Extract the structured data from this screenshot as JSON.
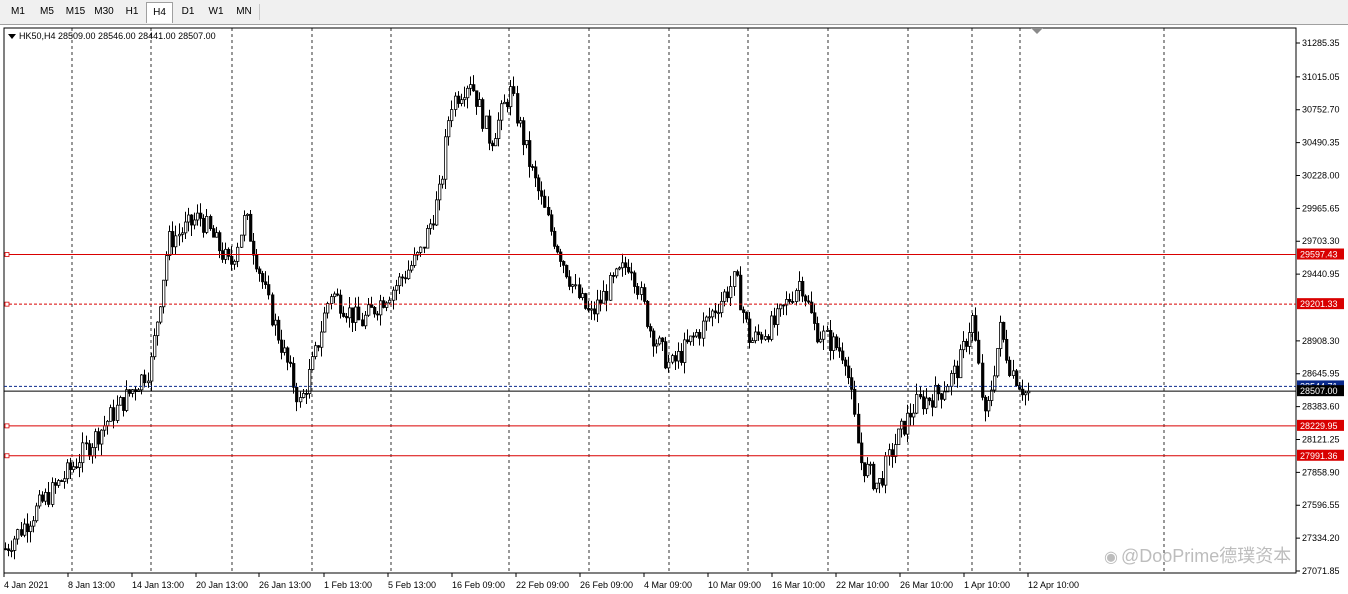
{
  "toolbar": {
    "timeframes": [
      "M1",
      "M5",
      "M15",
      "M30",
      "H1",
      "H4",
      "D1",
      "W1",
      "MN"
    ],
    "active": "H4"
  },
  "chart": {
    "symbol_info": "HK50,H4  28509.00 28546.00 28441.00 28507.00",
    "price_labels": [
      "31285.35",
      "31015.05",
      "30752.70",
      "30490.35",
      "30228.00",
      "29965.65",
      "29703.30",
      "29440.95",
      "28908.30",
      "28645.95",
      "28383.60",
      "28121.25",
      "27858.90",
      "27596.55",
      "27334.20",
      "27071.85"
    ],
    "date_labels": [
      "4 Jan 2021",
      "8 Jan 13:00",
      "14 Jan 13:00",
      "20 Jan 13:00",
      "26 Jan 13:00",
      "1 Feb 13:00",
      "5 Feb 13:00",
      "16 Feb 09:00",
      "22 Feb 09:00",
      "26 Feb 09:00",
      "4 Mar 09:00",
      "10 Mar 09:00",
      "16 Mar 10:00",
      "22 Mar 10:00",
      "26 Mar 10:00",
      "1 Apr 10:00",
      "12 Apr 10:00"
    ],
    "hlines": [
      {
        "price": 29597.43,
        "label": "29597.43",
        "color": "#d90000",
        "style": "solid"
      },
      {
        "price": 29201.33,
        "label": "29201.33",
        "color": "#d90000",
        "style": "dashed"
      },
      {
        "price": 28544.71,
        "label": "28544.71",
        "color": "#0a2a8c",
        "style": "dashed"
      },
      {
        "price": 28507.0,
        "label": "28507.00",
        "color": "#000000",
        "style": "solid"
      },
      {
        "price": 28229.95,
        "label": "28229.95",
        "color": "#d90000",
        "style": "solid"
      },
      {
        "price": 27991.36,
        "label": "27991.36",
        "color": "#d90000",
        "style": "solid"
      }
    ],
    "y_range": [
      27040,
      31350
    ]
  },
  "watermark": {
    "text": "@DooPrime德璞资本",
    "icon": "weibo-icon"
  },
  "colors": {
    "support_resistance": "#d90000",
    "bid_line": "#0a2a8c",
    "candle": "#000000"
  }
}
